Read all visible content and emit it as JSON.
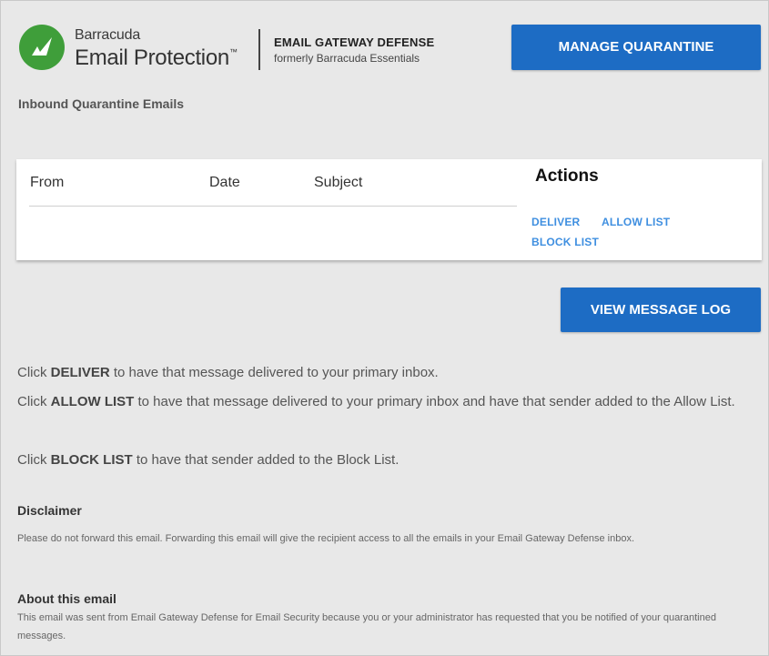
{
  "brand": {
    "name_small": "Barracuda",
    "name_big": "Email Protection",
    "trademark": "™",
    "product_name": "EMAIL GATEWAY DEFENSE",
    "product_subtitle": "formerly Barracuda Essentials",
    "logo_color": "#3f9e3a"
  },
  "header": {
    "manage_button": "MANAGE QUARANTINE"
  },
  "section_title": "Inbound Quarantine Emails",
  "table": {
    "headers": {
      "from": "From",
      "date": "Date",
      "subject": "Subject",
      "actions": "Actions"
    },
    "rows": [
      {
        "from": "",
        "date": "",
        "subject": "",
        "actions": [
          "DELIVER",
          "ALLOW LIST",
          "BLOCK LIST"
        ]
      }
    ]
  },
  "view_log_button": "VIEW MESSAGE LOG",
  "instructions": [
    {
      "prefix": "Click ",
      "keyword": "DELIVER",
      "suffix": " to have that message delivered to your primary inbox."
    },
    {
      "prefix": "Click ",
      "keyword": "ALLOW LIST",
      "suffix": " to have that message delivered to your primary inbox and have that sender added to the Allow List."
    },
    {
      "prefix": "Click ",
      "keyword": "BLOCK LIST",
      "suffix": " to have that sender added to the Block List."
    }
  ],
  "disclaimer": {
    "title": "Disclaimer",
    "text": "Please do not forward this email. Forwarding this email will give the recipient access to all the emails in your Email Gateway Defense inbox."
  },
  "about": {
    "title": "About this email",
    "text": "This email was sent from Email Gateway Defense for Email Security because you or your administrator has requested that you be notified of your quarantined messages."
  },
  "colors": {
    "button_blue": "#1d6cc4",
    "link_blue": "#3f8fe0",
    "background": "#e8e8e8"
  }
}
